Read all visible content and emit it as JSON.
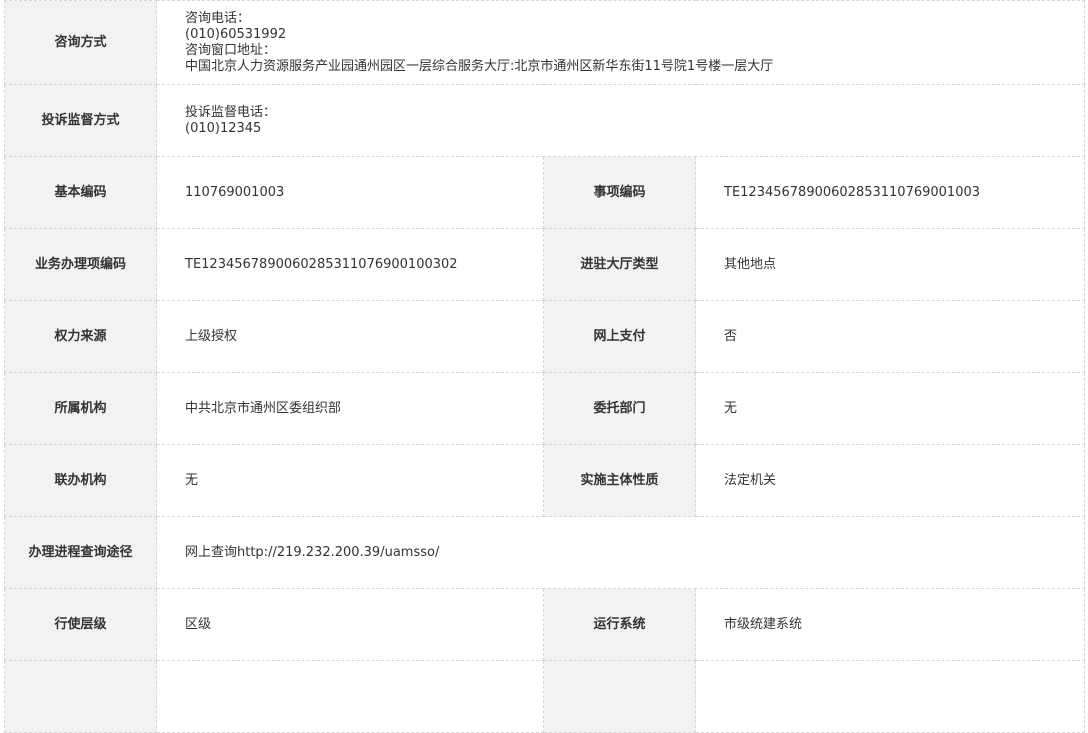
{
  "consult": {
    "label": "咨询方式",
    "phone_label": "咨询电话：",
    "phone": "(010)60531992",
    "address_label": "咨询窗口地址：",
    "address": "中国北京人力资源服务产业园通州园区一层综合服务大厅:北京市通州区新华东街11号院1号楼一层大厅"
  },
  "complaint": {
    "label": "投诉监督方式",
    "phone_label": "投诉监督电话：",
    "phone": "(010)12345"
  },
  "rows": [
    {
      "l1": "基本编码",
      "v1": "110769001003",
      "l2": "事项编码",
      "v2": "TE12345678900602853110769001003"
    },
    {
      "l1": "业务办理项编码",
      "v1": "TE1234567890060285311076900100302",
      "l2": "进驻大厅类型",
      "v2": "其他地点"
    },
    {
      "l1": "权力来源",
      "v1": "上级授权",
      "l2": "网上支付",
      "v2": "否"
    },
    {
      "l1": "所属机构",
      "v1": "中共北京市通州区委组织部",
      "l2": "委托部门",
      "v2": "无"
    },
    {
      "l1": "联办机构",
      "v1": "无",
      "l2": "实施主体性质",
      "v2": "法定机关"
    }
  ],
  "progress_query": {
    "label": "办理进程查询途径",
    "value": "网上查询http://219.232.200.39/uamsso/"
  },
  "last_row": {
    "l1": "行使层级",
    "v1": "区级",
    "l2": "运行系统",
    "v2": "市级统建系统"
  }
}
